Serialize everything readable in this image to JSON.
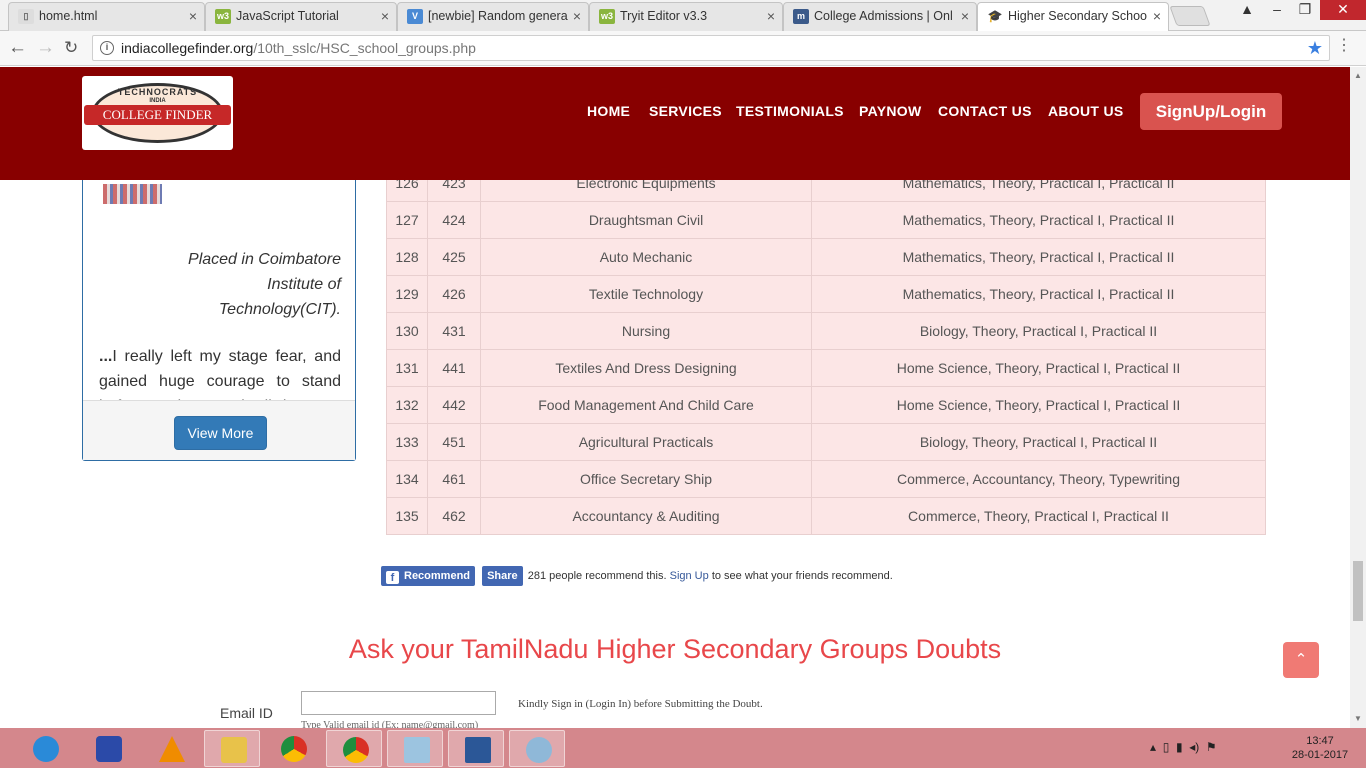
{
  "browser": {
    "tabs": [
      {
        "title": "home.html",
        "icon": "file-icon"
      },
      {
        "title": "JavaScript Tutorial",
        "icon": "w3schools-icon"
      },
      {
        "title": "[newbie] Random genera",
        "icon": "v-icon"
      },
      {
        "title": "Tryit Editor v3.3",
        "icon": "w3schools-icon"
      },
      {
        "title": "College Admissions | Onl",
        "icon": "m-icon"
      },
      {
        "title": "Higher Secondary Schoo",
        "icon": "graduate-icon",
        "active": true
      }
    ],
    "url_host": "indiacollegefinder.org",
    "url_path": "/10th_sslc/HSC_school_groups.php"
  },
  "header": {
    "logo_top": "TECHNOCRATS",
    "logo_india": "INDIA",
    "logo_main": "COLLEGE FINDER",
    "nav": [
      "HOME",
      "SERVICES",
      "TESTIMONIALS",
      "PAYNOW",
      "CONTACT US",
      "ABOUT US"
    ],
    "signup_label": "SignUp/Login",
    "bg_color": "#880000"
  },
  "testimonial": {
    "quote_top": "Placed in Coimbatore Institute of Technology(CIT).",
    "quote_lead": "...",
    "quote_body": "I really left my stage fear, and gained huge courage to stand before students and talk but now become really easy.",
    "view_more": "View More"
  },
  "table": {
    "rows": [
      [
        "126",
        "423",
        "Electronic Equipments",
        "Mathematics, Theory, Practical I, Practical II"
      ],
      [
        "127",
        "424",
        "Draughtsman Civil",
        "Mathematics, Theory, Practical I, Practical II"
      ],
      [
        "128",
        "425",
        "Auto Mechanic",
        "Mathematics, Theory, Practical I, Practical II"
      ],
      [
        "129",
        "426",
        "Textile Technology",
        "Mathematics, Theory, Practical I, Practical II"
      ],
      [
        "130",
        "431",
        "Nursing",
        "Biology, Theory, Practical I, Practical II"
      ],
      [
        "131",
        "441",
        "Textiles And Dress Designing",
        "Home Science, Theory, Practical I, Practical II"
      ],
      [
        "132",
        "442",
        "Food Management And Child Care",
        "Home Science, Theory, Practical I, Practical II"
      ],
      [
        "133",
        "451",
        "Agricultural Practicals",
        "Biology, Theory, Practical I, Practical II"
      ],
      [
        "134",
        "461",
        "Office Secretary Ship",
        "Commerce, Accountancy, Theory, Typewriting"
      ],
      [
        "135",
        "462",
        "Accountancy & Auditing",
        "Commerce, Theory, Practical I, Practical II"
      ]
    ]
  },
  "facebook": {
    "recommend": "Recommend",
    "share": "Share",
    "text": "281 people recommend this.",
    "signup": "Sign Up",
    "after": "to see what your friends recommend."
  },
  "ask": {
    "title": "Ask your TamilNadu Higher Secondary Groups Doubts",
    "email_label": "Email ID",
    "email_hint": "Type Valid email id (Ex: name@gmail.com)",
    "signin_note": "Kindly Sign in (Login In) before Submitting the Doubt."
  },
  "taskbar": {
    "apps": [
      "ie-icon",
      "remote-icon",
      "vlc-icon",
      "folder-icon",
      "chrome-icon",
      "chrome-active-icon",
      "notepad-icon",
      "word-icon",
      "paint-icon"
    ],
    "time": "13:47",
    "date": "28-01-2017"
  }
}
